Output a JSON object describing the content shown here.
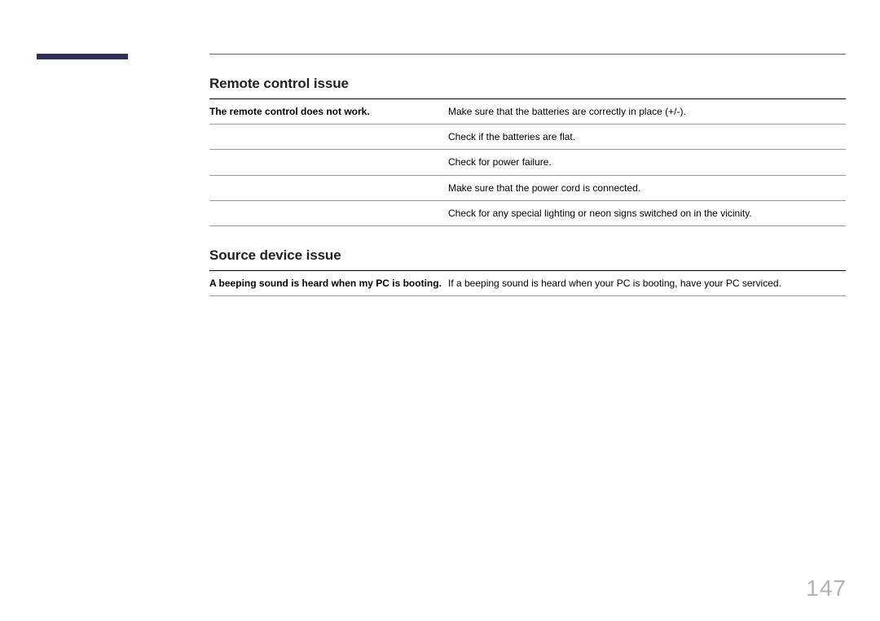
{
  "sections": [
    {
      "heading": "Remote control issue",
      "rows": [
        {
          "symptom": "The remote control does not work.",
          "solution": "Make sure that the batteries are correctly in place (+/-)."
        },
        {
          "symptom": "",
          "solution": "Check if the batteries are flat."
        },
        {
          "symptom": "",
          "solution": "Check for power failure."
        },
        {
          "symptom": "",
          "solution": "Make sure that the power cord is connected."
        },
        {
          "symptom": "",
          "solution": "Check for any special lighting or neon signs switched on in the vicinity."
        }
      ]
    },
    {
      "heading": "Source device issue",
      "rows": [
        {
          "symptom": "A beeping sound is heard when my PC is booting.",
          "solution": "If a beeping sound is heard when your PC is booting, have your PC serviced."
        }
      ]
    }
  ],
  "page_number": "147"
}
